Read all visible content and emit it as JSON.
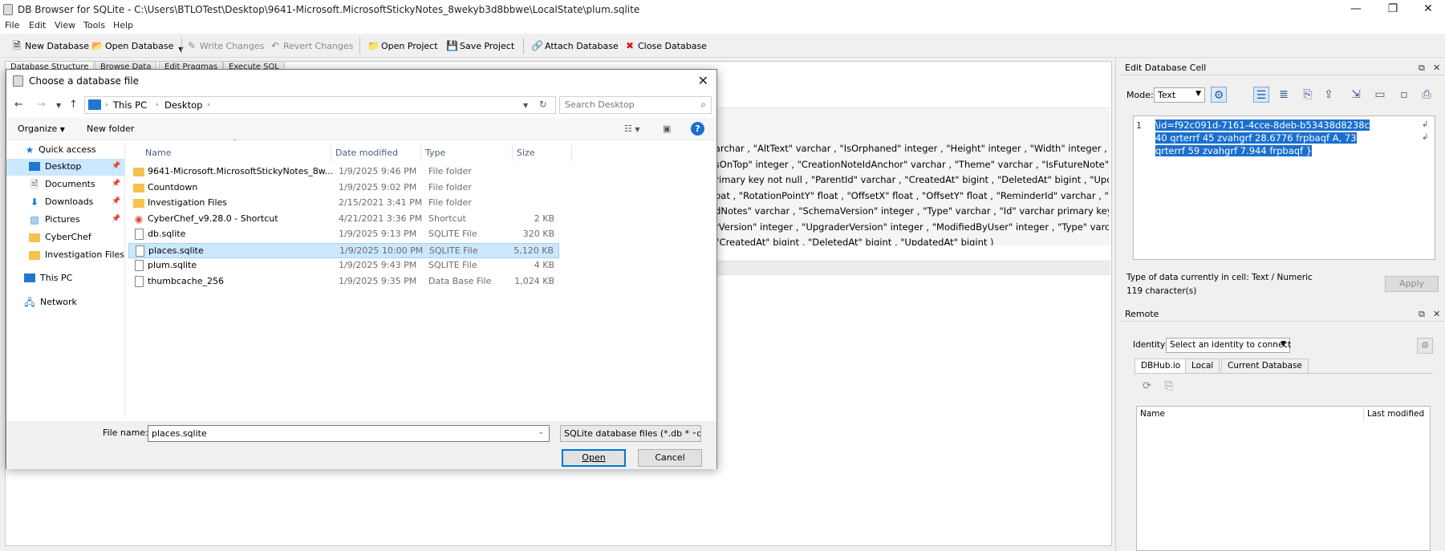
{
  "window": {
    "title": "DB Browser for SQLite - C:\\Users\\BTLOTest\\Desktop\\9641-Microsoft.MicrosoftStickyNotes_8wekyb3d8bbwe\\LocalState\\plum.sqlite",
    "controls": {
      "minimize": "—",
      "restore": "❐",
      "close": "✕"
    }
  },
  "menu": [
    "File",
    "Edit",
    "View",
    "Tools",
    "Help"
  ],
  "toolbar": {
    "new_db": "New Database",
    "open_db": "Open Database",
    "write_changes": "Write Changes",
    "revert_changes": "Revert Changes",
    "open_project": "Open Project",
    "save_project": "Save Project",
    "attach_db": "Attach Database",
    "close_db": "Close Database"
  },
  "main_tabs": [
    "Database Structure",
    "Browse Data",
    "Edit Pragmas",
    "Execute SQL"
  ],
  "schema_lines": [
    "varchar , \"AltText\" varchar , \"IsOrphaned\" integer , \"Height\" integer , \"Width\" integer , \"Type",
    "ysOnTop\" integer , \"CreationNoteIdAnchor\" varchar , \"Theme\" varchar , \"IsFutureNote\" inte",
    " primary key not null , \"ParentId\" varchar , \"CreatedAt\" bigint , \"DeletedAt\" bigint , \"Update",
    "float , \"RotationPointY\" float , \"OffsetX\" float , \"OffsetY\" float , \"ReminderId\" varchar , \"Strok",
    "edNotes\" varchar , \"SchemaVersion\" integer , \"Type\" varchar , \"Id\" varchar primary key not",
    "erVersion\" integer , \"UpgraderVersion\" integer , \"ModifiedByUser\" integer , \"Type\" varchar",
    ", \"CreatedAt\" bigint , \"DeletedAt\" bigint , \"UpdatedAt\" bigint )"
  ],
  "edit_cell": {
    "panel_title": "Edit Database Cell",
    "mode_label": "Mode:",
    "mode_value": "Text",
    "line_number": "1",
    "cell_text": "\\id=f92c091d-7161-4cce-8deb-b53438d8238c 40 qrterrf 45 zvahgrf 28.6776 frpbaqf A, 73 qrterrf 59 zvahgrf 7.944 frpbaqf }",
    "type_info": "Type of data currently in cell: Text / Numeric",
    "char_count": "119 character(s)",
    "apply": "Apply"
  },
  "remote": {
    "panel_title": "Remote",
    "identity_label": "Identity",
    "identity_value": "Select an identity to connect",
    "tabs": [
      "DBHub.io",
      "Local",
      "Current Database"
    ],
    "col_name": "Name",
    "col_modified": "Last modified"
  },
  "dialog": {
    "title": "Choose a database file",
    "path": [
      "This PC",
      "Desktop"
    ],
    "search_placeholder": "Search Desktop",
    "organize": "Organize",
    "new_folder": "New folder",
    "nav": [
      {
        "label": "Quick access",
        "icon": "star-icon",
        "pinned": false
      },
      {
        "label": "Desktop",
        "icon": "desktop-icon",
        "pinned": true
      },
      {
        "label": "Documents",
        "icon": "documents-icon",
        "pinned": true
      },
      {
        "label": "Downloads",
        "icon": "download-icon",
        "pinned": true
      },
      {
        "label": "Pictures",
        "icon": "pictures-icon",
        "pinned": true
      },
      {
        "label": "CyberChef",
        "icon": "folder-icon",
        "pinned": false
      },
      {
        "label": "Investigation Files",
        "icon": "folder-icon",
        "pinned": false
      },
      {
        "label": "This PC",
        "icon": "computer-icon",
        "pinned": false
      },
      {
        "label": "Network",
        "icon": "network-icon",
        "pinned": false
      }
    ],
    "columns": [
      "Name",
      "Date modified",
      "Type",
      "Size"
    ],
    "files": [
      {
        "name": "9641-Microsoft.MicrosoftStickyNotes_8w...",
        "date": "1/9/2025 9:46 PM",
        "type": "File folder",
        "size": "",
        "icon": "folder-icon"
      },
      {
        "name": "Countdown",
        "date": "1/9/2025 9:02 PM",
        "type": "File folder",
        "size": "",
        "icon": "folder-icon"
      },
      {
        "name": "Investigation Files",
        "date": "2/15/2021 3:41 PM",
        "type": "File folder",
        "size": "",
        "icon": "folder-icon"
      },
      {
        "name": "CyberChef_v9.28.0 - Shortcut",
        "date": "4/21/2021 3:36 PM",
        "type": "Shortcut",
        "size": "2 KB",
        "icon": "chrome-icon"
      },
      {
        "name": "db.sqlite",
        "date": "1/9/2025 9:13 PM",
        "type": "SQLITE File",
        "size": "320 KB",
        "icon": "file-icon"
      },
      {
        "name": "places.sqlite",
        "date": "1/9/2025 10:00 PM",
        "type": "SQLITE File",
        "size": "5,120 KB",
        "icon": "file-icon"
      },
      {
        "name": "plum.sqlite",
        "date": "1/9/2025 9:43 PM",
        "type": "SQLITE File",
        "size": "4 KB",
        "icon": "file-icon"
      },
      {
        "name": "thumbcache_256",
        "date": "1/9/2025 9:35 PM",
        "type": "Data Base File",
        "size": "1,024 KB",
        "icon": "file-icon"
      }
    ],
    "selected_index": 5,
    "filename_label": "File name:",
    "filename_value": "places.sqlite",
    "filter_value": "SQLite database files (*.db *.sql",
    "open": "Open",
    "cancel": "Cancel"
  }
}
